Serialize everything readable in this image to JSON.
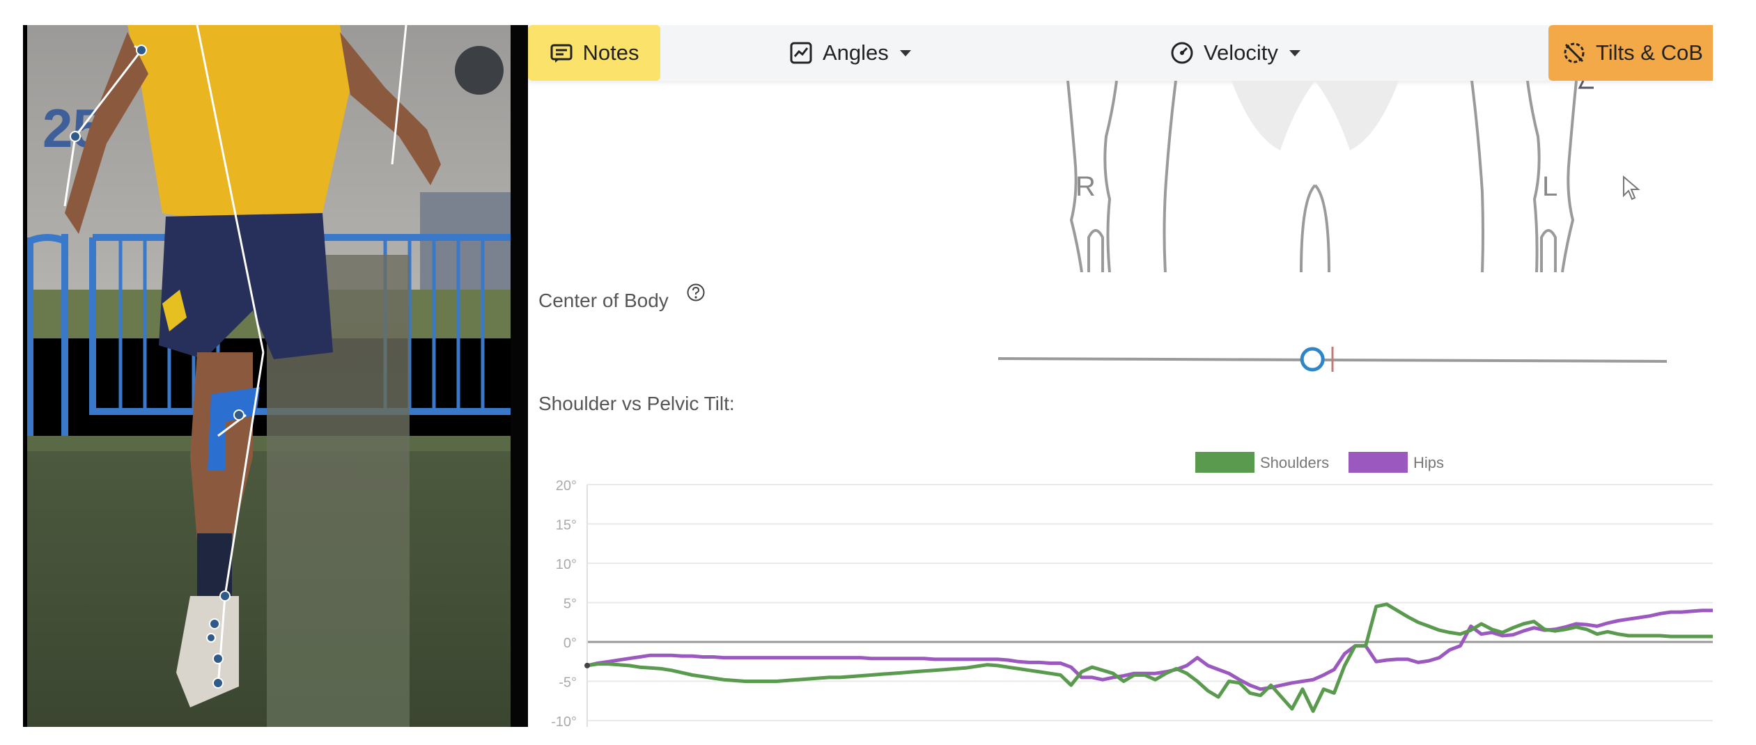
{
  "toolbar": {
    "notes_label": "Notes",
    "angles_label": "Angles",
    "velocity_label": "Velocity",
    "tilts_label": "Tilts & CoB"
  },
  "video": {
    "wall_number": "25"
  },
  "body_diagram": {
    "right_label": "R",
    "left_label": "L"
  },
  "center_of_body": {
    "label": "Center of Body",
    "help_icon": "question-circle-icon",
    "position": 0.47
  },
  "chart_data": {
    "type": "line",
    "title": "Shoulder vs Pelvic Tilt:",
    "ylabel": "",
    "xlabel": "",
    "ylim": [
      -12,
      20
    ],
    "yticks": [
      "20°",
      "15°",
      "10°",
      "5°",
      "0°",
      "-5°",
      "-10°"
    ],
    "ytick_values": [
      20,
      15,
      10,
      5,
      0,
      -5,
      -10
    ],
    "legend_position": "top-center",
    "grid": true,
    "cursor_x": 108,
    "series": [
      {
        "name": "Shoulders",
        "color": "#5a9a4e",
        "values": [
          -3.0,
          -2.8,
          -2.8,
          -2.9,
          -3.0,
          -3.2,
          -3.3,
          -3.4,
          -3.6,
          -3.9,
          -4.2,
          -4.4,
          -4.6,
          -4.8,
          -4.9,
          -5.0,
          -5.0,
          -5.0,
          -5.0,
          -4.9,
          -4.8,
          -4.7,
          -4.6,
          -4.5,
          -4.5,
          -4.4,
          -4.3,
          -4.2,
          -4.1,
          -4.0,
          -3.9,
          -3.8,
          -3.7,
          -3.6,
          -3.5,
          -3.4,
          -3.3,
          -3.1,
          -2.9,
          -3.0,
          -3.2,
          -3.4,
          -3.6,
          -3.8,
          -4.0,
          -4.2,
          -5.5,
          -3.8,
          -3.2,
          -3.6,
          -4.0,
          -5.0,
          -4.2,
          -4.2,
          -4.8,
          -4.0,
          -3.4,
          -4.0,
          -5.0,
          -6.2,
          -7.0,
          -5.0,
          -5.2,
          -6.5,
          -6.8,
          -5.5,
          -7.0,
          -8.5,
          -6.0,
          -8.8,
          -6.0,
          -6.5,
          -3.0,
          -0.5,
          -0.5,
          4.5,
          4.8,
          4.0,
          3.2,
          2.5,
          2.0,
          1.5,
          1.2,
          1.0,
          1.5,
          2.3,
          1.6,
          1.2,
          1.8,
          2.3,
          2.6,
          1.6,
          1.4,
          1.6,
          1.9,
          1.6,
          1.0,
          1.3,
          1.0,
          0.8,
          0.8,
          0.8,
          0.8,
          0.7,
          0.7,
          0.7,
          0.7,
          0.7
        ]
      },
      {
        "name": "Hips",
        "color": "#9b59c0",
        "values": [
          -3.0,
          -2.7,
          -2.5,
          -2.3,
          -2.1,
          -1.9,
          -1.7,
          -1.7,
          -1.7,
          -1.8,
          -1.8,
          -1.9,
          -1.9,
          -2.0,
          -2.0,
          -2.0,
          -2.0,
          -2.0,
          -2.0,
          -2.0,
          -2.0,
          -2.0,
          -2.0,
          -2.0,
          -2.0,
          -2.0,
          -2.0,
          -2.1,
          -2.1,
          -2.1,
          -2.1,
          -2.1,
          -2.1,
          -2.2,
          -2.2,
          -2.2,
          -2.2,
          -2.2,
          -2.2,
          -2.2,
          -2.3,
          -2.5,
          -2.6,
          -2.6,
          -2.7,
          -2.7,
          -3.2,
          -4.5,
          -4.5,
          -4.8,
          -4.5,
          -4.3,
          -4.0,
          -4.0,
          -4.0,
          -3.8,
          -3.5,
          -3.0,
          -2.0,
          -3.0,
          -3.5,
          -4.0,
          -4.8,
          -5.5,
          -6.0,
          -5.8,
          -5.5,
          -5.2,
          -5.0,
          -4.8,
          -4.2,
          -3.5,
          -1.5,
          -0.5,
          -0.5,
          -2.5,
          -2.3,
          -2.2,
          -2.2,
          -2.6,
          -2.4,
          -2.0,
          -1.0,
          -0.5,
          2.0,
          1.0,
          1.2,
          0.8,
          0.9,
          1.4,
          1.8,
          1.5,
          1.6,
          1.9,
          2.3,
          2.2,
          2.0,
          2.4,
          2.7,
          2.9,
          3.1,
          3.3,
          3.6,
          3.8,
          3.8,
          3.9,
          4.0,
          4.0
        ]
      }
    ]
  }
}
